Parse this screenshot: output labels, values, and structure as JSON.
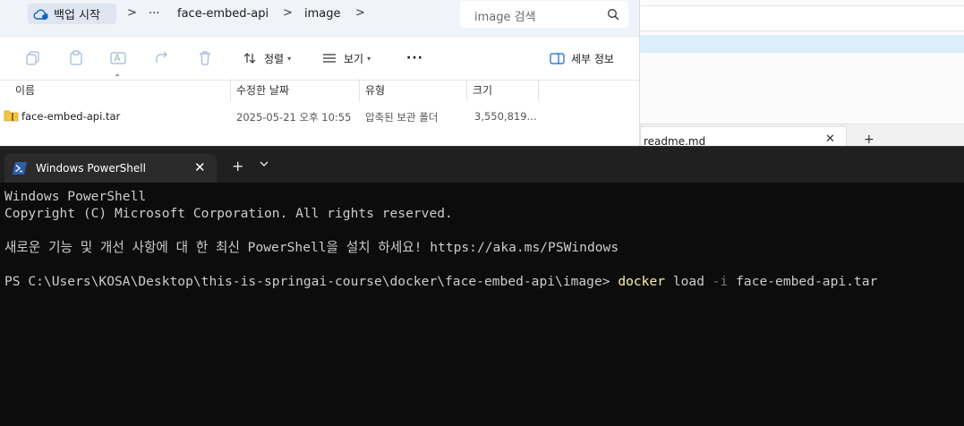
{
  "explorer": {
    "breadcrumb": {
      "home_label": "백업 시작",
      "ellipsis": "···",
      "crumbs": [
        "face-embed-api",
        "image"
      ],
      "separator": ">"
    },
    "search": {
      "placeholder": "image 검색"
    },
    "commandbar": {
      "sort_label": "정렬",
      "view_label": "보기",
      "more_label": "···",
      "details_label": "세부 정보"
    },
    "columns": [
      "이름",
      "수정한 날짜",
      "유형",
      "크기"
    ],
    "files": [
      {
        "name": "face-embed-api.tar",
        "modified": "2025-05-21 오후 10:55",
        "type": "압축된 보관 폴더",
        "size": "3,550,819..."
      }
    ]
  },
  "background_window": {
    "tab_label": "readme.md",
    "close": "✕",
    "add": "+"
  },
  "terminal": {
    "tab_title": "Windows PowerShell",
    "tab_close": "✕",
    "new_tab": "+",
    "lines": [
      "Windows PowerShell",
      "Copyright (C) Microsoft Corporation. All rights reserved.",
      "",
      "새로운 기능 및 개선 사항에 대 한 최신 PowerShell을 설치 하세요! https://aka.ms/PSWindows",
      ""
    ],
    "prompt": "PS C:\\Users\\KOSA\\Desktop\\this-is-springai-course\\docker\\face-embed-api\\image> ",
    "command": {
      "name": "docker",
      "arg1": " load ",
      "flag": "-i",
      "arg2": " face-embed-api.tar"
    }
  },
  "colors": {
    "terminal_bg": "#0c0c0c",
    "terminal_text": "#cccccc",
    "command_highlight": "#f9f1a5",
    "flag_color": "#767676",
    "selected_row": "#dbeefc"
  }
}
